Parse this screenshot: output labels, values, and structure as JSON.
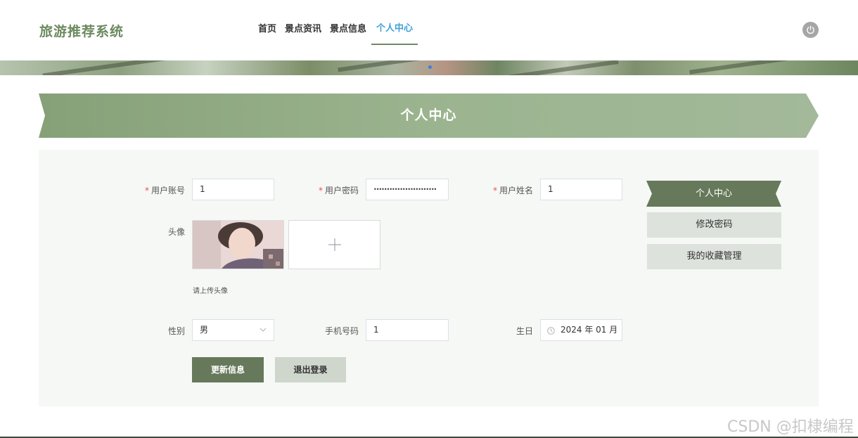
{
  "app": {
    "title": "旅游推荐系统"
  },
  "nav": {
    "items": [
      "首页",
      "景点资讯",
      "景点信息",
      "个人中心"
    ],
    "active_index": 3
  },
  "page": {
    "title": "个人中心"
  },
  "form": {
    "account": {
      "label": "用户账号",
      "value": "1",
      "required": "*"
    },
    "password": {
      "label": "用户密码",
      "value": "••••••••••••••••••••••••",
      "required": "*"
    },
    "name": {
      "label": "用户姓名",
      "value": "1",
      "required": "*"
    },
    "avatar": {
      "label": "头像",
      "upload_icon": "plus-icon",
      "hint": "请上传头像"
    },
    "gender": {
      "label": "性别",
      "value": "男"
    },
    "phone": {
      "label": "手机号码",
      "value": "1"
    },
    "birthday": {
      "label": "生日",
      "value": "2024 年 01 月"
    },
    "buttons": {
      "update": "更新信息",
      "logout": "退出登录"
    }
  },
  "side_menu": {
    "items": [
      "个人中心",
      "修改密码",
      "我的收藏管理"
    ],
    "active_index": 0
  },
  "watermark": "CSDN @扣棣编程",
  "colors": {
    "brand": "#6c8a5f",
    "accent": "#3fa0d8",
    "ribbon": "#94ad8a",
    "button": "#66795a",
    "required": "#e6524f"
  },
  "icons": {
    "power": "power-icon",
    "clock": "clock-icon",
    "dropdown": "chevron-down-icon"
  }
}
